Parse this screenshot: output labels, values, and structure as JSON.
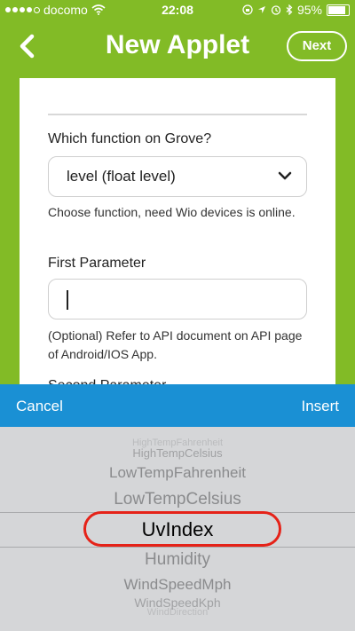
{
  "status_bar": {
    "carrier": "docomo",
    "time": "22:08",
    "battery": "95%",
    "battery_level": 0.95,
    "signal_bars_filled": 4
  },
  "nav": {
    "title": "New Applet",
    "next_label": "Next"
  },
  "form": {
    "function_label": "Which function on Grove?",
    "function_value": "level (float level)",
    "function_help": "Choose function, need Wio devices is online.",
    "first_param_label": "First Parameter",
    "first_param_value": "",
    "first_param_help": "(Optional) Refer to API document on API page of Android/IOS App.",
    "second_param_label": "Second Parameter"
  },
  "picker": {
    "cancel_label": "Cancel",
    "insert_label": "Insert",
    "items": [
      "HighTempFahrenheit",
      "HighTempCelsius",
      "LowTempFahrenheit",
      "LowTempCelsius",
      "UvIndex",
      "Humidity",
      "WindSpeedMph",
      "WindSpeedKph",
      "WindDirection"
    ],
    "selected": "UvIndex"
  },
  "colors": {
    "brand_green": "#82bb26",
    "toolbar_blue": "#1a90d4",
    "highlight_red": "#e52218"
  },
  "icons": [
    "wifi-icon",
    "rotation-lock-icon",
    "location-icon",
    "alarm-icon",
    "bluetooth-icon",
    "battery-icon",
    "back-chevron-icon",
    "chevron-down-icon"
  ]
}
